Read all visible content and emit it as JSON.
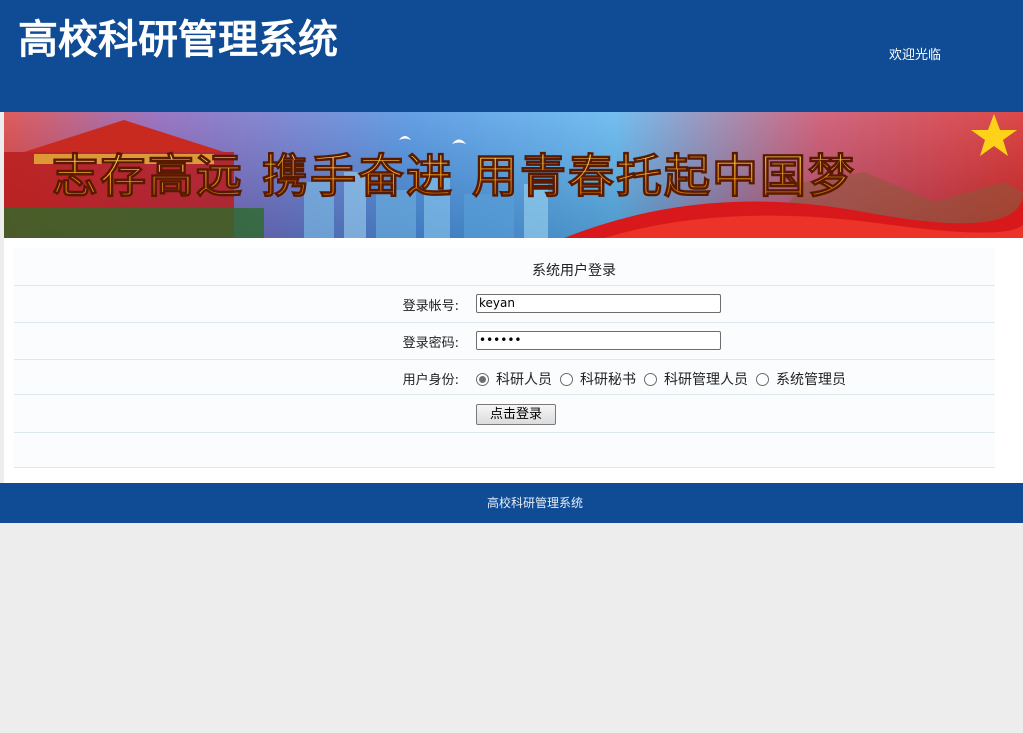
{
  "header": {
    "title": "高校科研管理系统",
    "welcome": "欢迎光临"
  },
  "banner": {
    "slogan": "志存高远  携手奋进  用青春托起中国梦"
  },
  "login": {
    "title": "系统用户登录",
    "account_label": "登录帐号:",
    "account_value": "keyan",
    "password_label": "登录密码:",
    "password_value": "keyan1",
    "role_label": "用户身份:",
    "roles": [
      {
        "label": "科研人员",
        "checked": true
      },
      {
        "label": "科研秘书",
        "checked": false
      },
      {
        "label": "科研管理人员",
        "checked": false
      },
      {
        "label": "系统管理员",
        "checked": false
      }
    ],
    "submit_label": "点击登录"
  },
  "footer": {
    "text": "高校科研管理系统"
  },
  "colors": {
    "brand_blue": "#0f4c95",
    "page_background": "#ededed"
  }
}
